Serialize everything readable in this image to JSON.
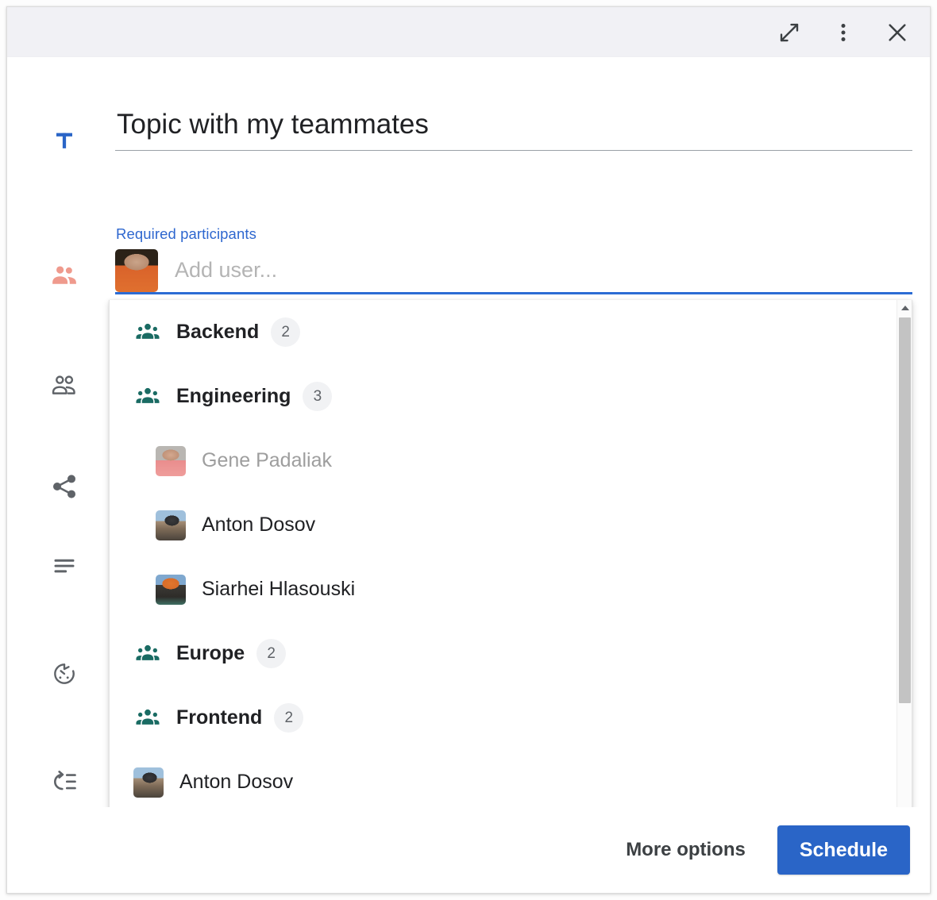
{
  "window": {
    "titlebar": {
      "expand_label": "Expand",
      "more_label": "More actions",
      "close_label": "Close"
    }
  },
  "rail": {
    "items": [
      {
        "name": "title-icon",
        "label": "T",
        "tooltip": "Title"
      },
      {
        "name": "required-participants-icon",
        "label": "",
        "tooltip": "Required participants"
      },
      {
        "name": "optional-participants-icon",
        "label": "",
        "tooltip": "Optional participants"
      },
      {
        "name": "share-icon",
        "label": "",
        "tooltip": "Share"
      },
      {
        "name": "description-icon",
        "label": "",
        "tooltip": "Description"
      },
      {
        "name": "duration-icon",
        "label": "",
        "tooltip": "Duration"
      },
      {
        "name": "recurrence-icon",
        "label": "",
        "tooltip": "Recurrence"
      }
    ]
  },
  "form": {
    "title_value": "Topic with my teammates",
    "title_placeholder": "Title",
    "participants_label": "Required participants",
    "add_user_value": "",
    "add_user_placeholder": "Add user...",
    "current_user_avatar": "gene-padaliak-avatar"
  },
  "dropdown": {
    "items": [
      {
        "type": "group",
        "label": "Backend",
        "count": "2",
        "avatar": "",
        "indent": false,
        "disabled": false
      },
      {
        "type": "group",
        "label": "Engineering",
        "count": "3",
        "avatar": "",
        "indent": false,
        "disabled": false
      },
      {
        "type": "member",
        "label": "Gene Padaliak",
        "count": "",
        "avatar": "av-gene-small",
        "indent": true,
        "disabled": true
      },
      {
        "type": "member",
        "label": "Anton Dosov",
        "count": "",
        "avatar": "av-anton",
        "indent": true,
        "disabled": false
      },
      {
        "type": "member",
        "label": "Siarhei Hlasouski",
        "count": "",
        "avatar": "av-siarhei",
        "indent": true,
        "disabled": false
      },
      {
        "type": "group",
        "label": "Europe",
        "count": "2",
        "avatar": "",
        "indent": false,
        "disabled": false
      },
      {
        "type": "group",
        "label": "Frontend",
        "count": "2",
        "avatar": "",
        "indent": false,
        "disabled": false
      },
      {
        "type": "member",
        "label": "Anton Dosov",
        "count": "",
        "avatar": "av-anton",
        "indent": false,
        "disabled": false
      },
      {
        "type": "clipped",
        "label": "",
        "count": "",
        "avatar": "av-partial",
        "indent": false,
        "disabled": false
      }
    ],
    "scrollbar": {
      "up_label": "Scroll up",
      "down_label": "Scroll down"
    }
  },
  "footer": {
    "more_options_label": "More options",
    "schedule_label": "Schedule"
  },
  "colors": {
    "accent_blue": "#2a65c7",
    "link_blue": "#2e67cf",
    "group_teal": "#1a6b63",
    "rail_active_salmon": "#ef9a8d",
    "titlebar_bg": "#f1f1f5",
    "badge_bg": "#f1f2f4",
    "disabled_text": "#9e9e9e"
  }
}
